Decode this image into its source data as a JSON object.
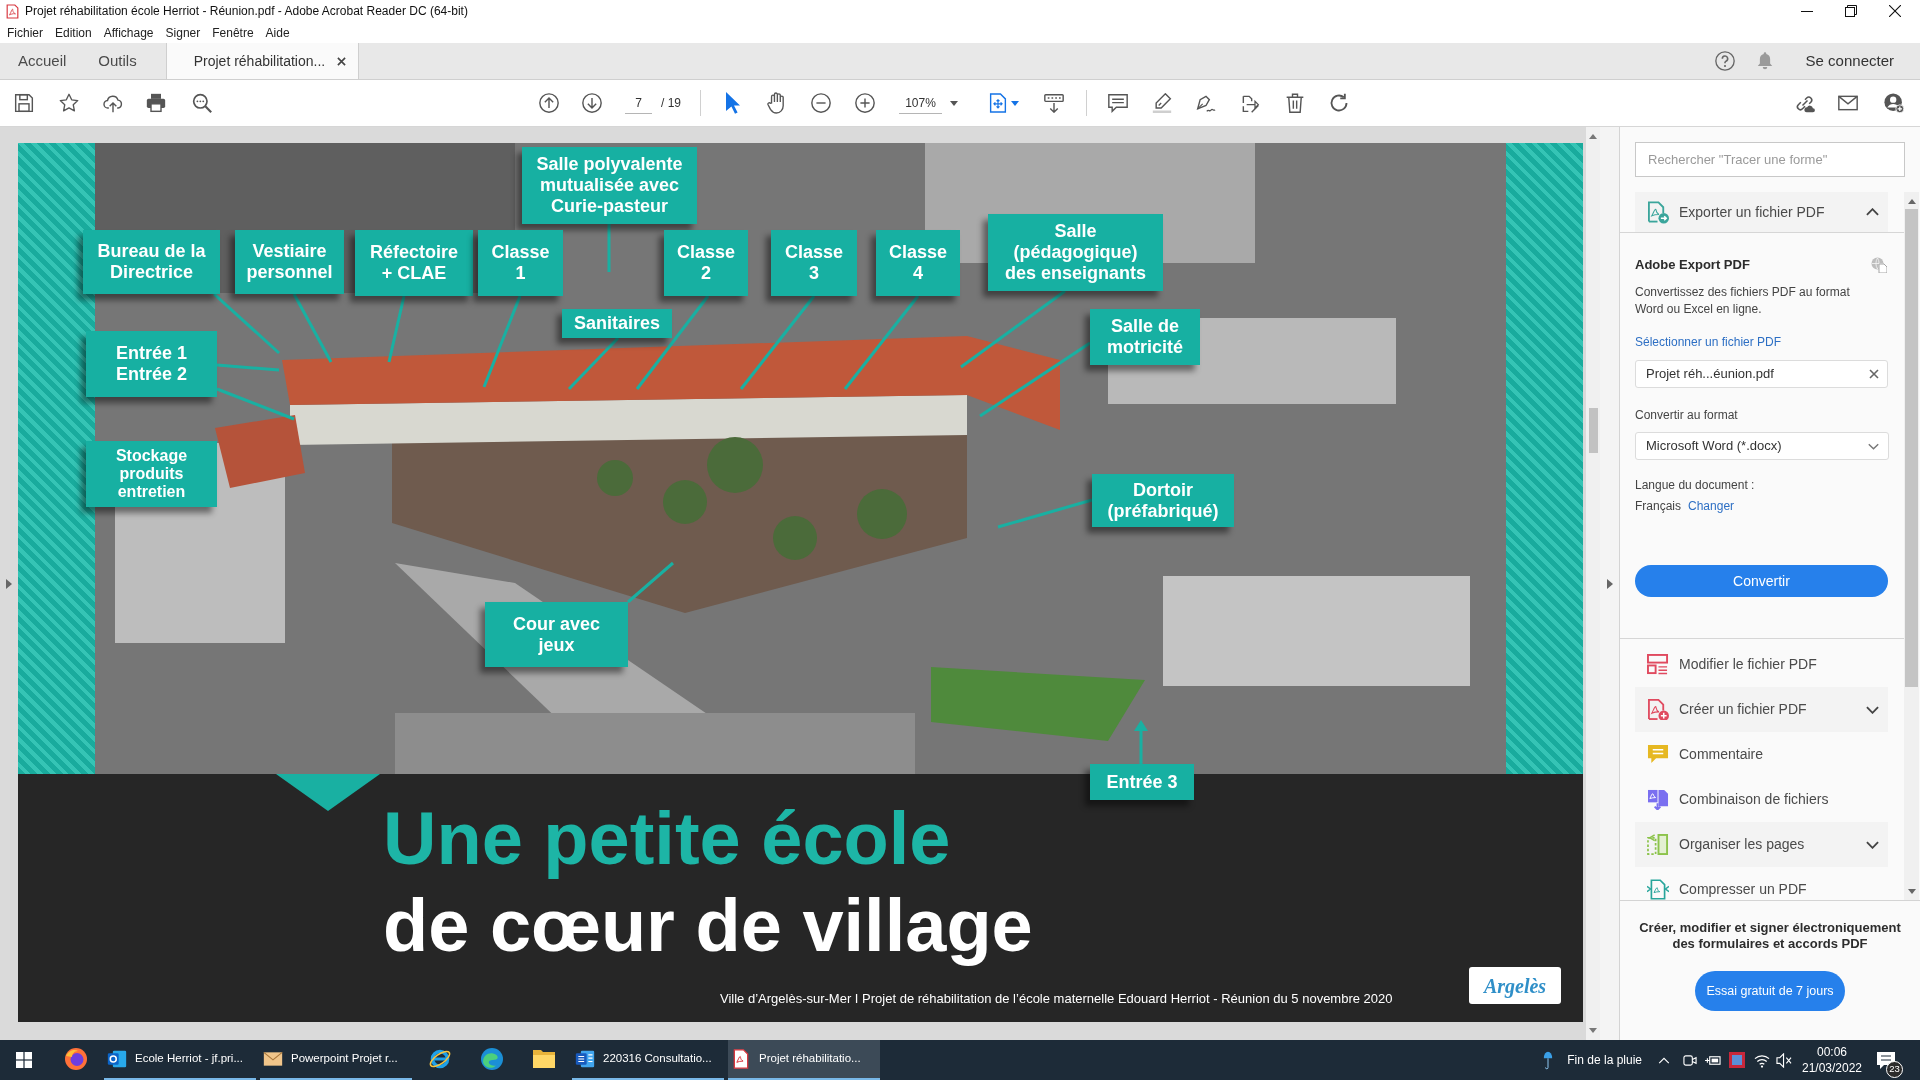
{
  "window": {
    "title": "Projet réhabilitation école Herriot - Réunion.pdf - Adobe Acrobat Reader DC (64-bit)"
  },
  "menu_bar": [
    "Fichier",
    "Edition",
    "Affichage",
    "Signer",
    "Fenêtre",
    "Aide"
  ],
  "tabs": [
    {
      "kind": "nav",
      "label": "Accueil",
      "selected": false
    },
    {
      "kind": "nav",
      "label": "Outils",
      "selected": false
    },
    {
      "kind": "document",
      "label": "Projet réhabilitation...",
      "selected": true
    }
  ],
  "account": {
    "sign_in": "Se connecter"
  },
  "toolbar": {
    "page_field": {
      "value": "7"
    },
    "page_total": "/ 19",
    "zoom_field": {
      "value": "107%"
    },
    "tools": [
      {
        "kind": "select",
        "selected": true
      },
      {
        "kind": "hand",
        "selected": false
      }
    ]
  },
  "slide": {
    "callouts": [
      {
        "lines": [
          "Salle polyvalente",
          "mutualisée avec",
          "Curie-pasteur"
        ]
      },
      {
        "lines": [
          "Bureau de la",
          "Directrice"
        ]
      },
      {
        "lines": [
          "Vestiaire",
          "personnel"
        ]
      },
      {
        "lines": [
          "Réfectoire",
          "+ CLAE"
        ]
      },
      {
        "lines": [
          "Classe",
          "1"
        ]
      },
      {
        "lines": [
          "Classe",
          "2"
        ]
      },
      {
        "lines": [
          "Classe",
          "3"
        ]
      },
      {
        "lines": [
          "Classe",
          "4"
        ]
      },
      {
        "lines": [
          "Salle",
          "(pédagogique)",
          "des enseignants"
        ]
      },
      {
        "lines": [
          "Sanitaires"
        ]
      },
      {
        "lines": [
          "Salle de",
          "motricité"
        ]
      },
      {
        "lines": [
          "Entrée 1",
          "Entrée 2"
        ]
      },
      {
        "lines": [
          "Stockage",
          "produits",
          "entretien"
        ]
      },
      {
        "lines": [
          "Dortoir",
          "(préfabriqué)"
        ]
      },
      {
        "lines": [
          "Cour avec",
          "jeux"
        ]
      },
      {
        "lines": [
          "Entrée 3"
        ]
      }
    ],
    "title_lines": [
      "Une petite école",
      "de cœur de village"
    ],
    "footer": "Ville d’Argelès-sur-Mer I Projet de réhabilitation de l’école maternelle Edouard Herriot - Réunion du 5 novembre 2020",
    "logo_text": "Argelès"
  },
  "tools_panel": {
    "search": {
      "placeholder": "Rechercher \"Tracer une forme\""
    },
    "export": {
      "title": "Exporter un fichier PDF",
      "expanded": true,
      "heading": "Adobe Export PDF",
      "description": "Convertissez des fichiers PDF au format Word ou Excel en ligne.",
      "file_label": "Sélectionner un fichier PDF",
      "file_field": {
        "value": "Projet réh...éunion.pdf"
      },
      "format_label": "Convertir au format",
      "format_select": {
        "value": "Microsoft Word (*.docx)"
      },
      "language_label": "Langue du document :",
      "language": "Français",
      "change_link": "Changer",
      "convert_button": "Convertir"
    },
    "tools": [
      {
        "kind": "edit",
        "label": "Modifier le fichier PDF",
        "expandable": false
      },
      {
        "kind": "create",
        "label": "Créer un fichier PDF",
        "expandable": true
      },
      {
        "kind": "comment",
        "label": "Commentaire",
        "expandable": false
      },
      {
        "kind": "combine",
        "label": "Combinaison de fichiers",
        "expandable": false
      },
      {
        "kind": "organize",
        "label": "Organiser les pages",
        "expandable": true
      },
      {
        "kind": "compress",
        "label": "Compresser un PDF",
        "expandable": false
      }
    ],
    "promo": {
      "text": "Créer, modifier et signer électroniquement des formulaires et accords PDF",
      "button": "Essai gratuit de 7 jours"
    }
  },
  "taskbar": {
    "apps": [
      {
        "kind": "fox",
        "selected": false,
        "running": false
      },
      {
        "kind": "mail",
        "label": "Ecole Herriot - jf.pri...",
        "selected": false,
        "running": true
      },
      {
        "kind": "envelope",
        "label": "Powerpoint Projet r...",
        "selected": false,
        "running": true
      },
      {
        "kind": "orbit",
        "selected": false,
        "running": false
      },
      {
        "kind": "swirl",
        "selected": false,
        "running": false
      },
      {
        "kind": "folder",
        "selected": false,
        "running": false
      },
      {
        "kind": "word",
        "label": "220316 Consultatio...",
        "selected": false,
        "running": true
      },
      {
        "kind": "pdf",
        "label": "Projet réhabilitatio...",
        "selected": true,
        "running": true
      }
    ],
    "weather": "Fin de la pluie",
    "time": "00:06",
    "date": "21/03/2022",
    "notifications": "23"
  }
}
